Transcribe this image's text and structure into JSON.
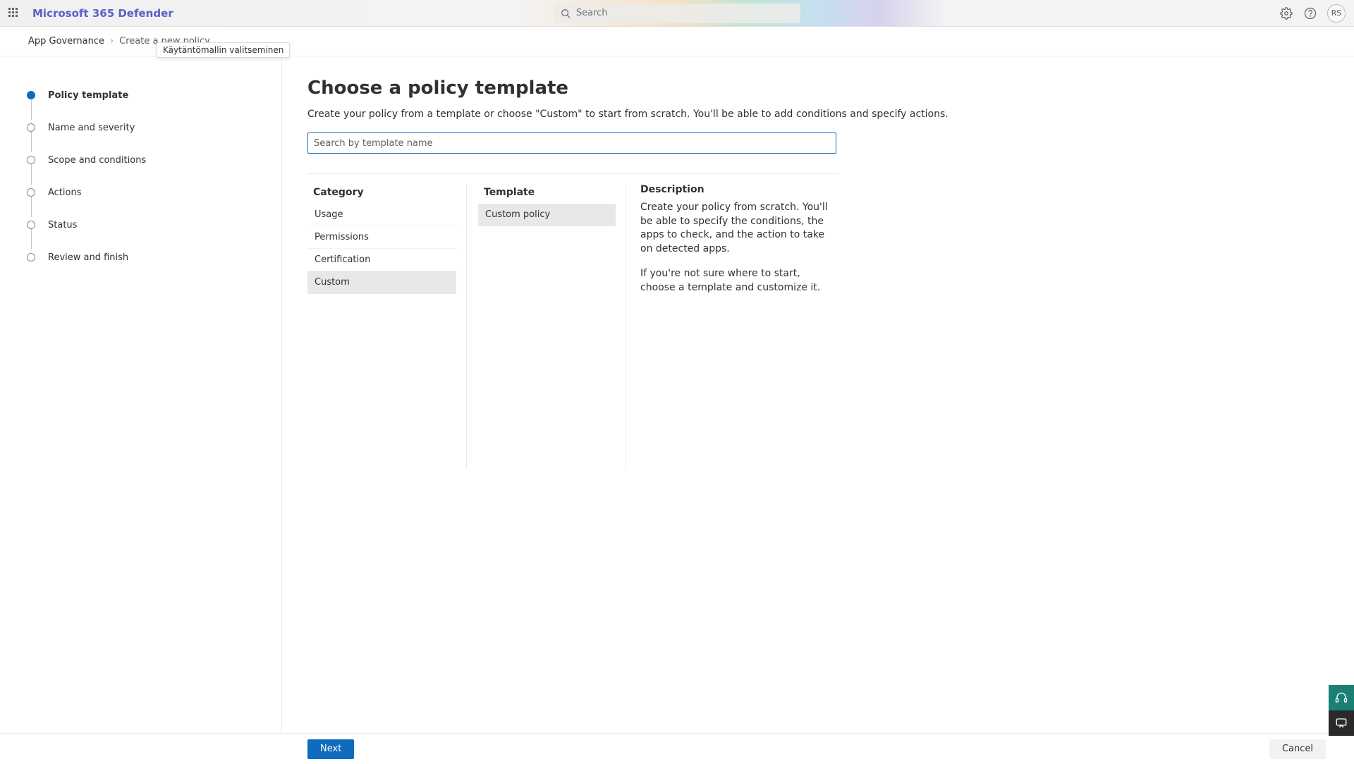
{
  "header": {
    "brand": "Microsoft 365 Defender",
    "search_placeholder": "Search",
    "avatar_initials": "RS"
  },
  "breadcrumb": {
    "root": "App Governance",
    "current": "Create a new policy",
    "tooltip": "Käytäntömallin valitseminen"
  },
  "steps": [
    {
      "label": "Policy template",
      "active": true
    },
    {
      "label": "Name and severity",
      "active": false
    },
    {
      "label": "Scope and conditions",
      "active": false
    },
    {
      "label": "Actions",
      "active": false
    },
    {
      "label": "Status",
      "active": false
    },
    {
      "label": "Review and finish",
      "active": false
    }
  ],
  "main": {
    "title": "Choose a policy template",
    "subtitle": "Create your policy from a template or choose \"Custom\" to start from scratch. You'll be able to add conditions and specify actions.",
    "search_placeholder": "Search by template name",
    "category_heading": "Category",
    "categories": [
      {
        "label": "Usage",
        "selected": false
      },
      {
        "label": "Permissions",
        "selected": false
      },
      {
        "label": "Certification",
        "selected": false
      },
      {
        "label": "Custom",
        "selected": true
      }
    ],
    "template_heading": "Template",
    "templates": [
      {
        "label": "Custom policy",
        "selected": true
      }
    ],
    "description_heading": "Description",
    "description_para1": "Create your policy from scratch. You'll be able to specify the conditions, the apps to check, and the action to take on detected apps.",
    "description_para2": "If you're not sure where to start, choose a template and customize it."
  },
  "footer": {
    "next": "Next",
    "cancel": "Cancel"
  }
}
